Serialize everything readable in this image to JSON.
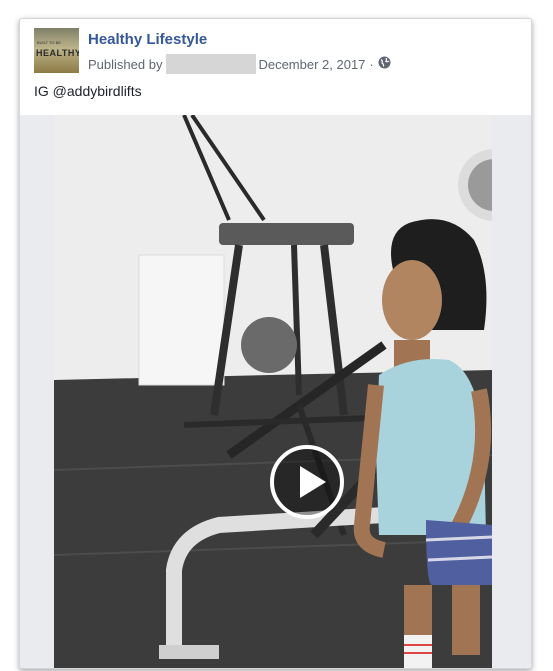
{
  "post": {
    "page_name": "Healthy Lifestyle",
    "published_by_label": "Published by",
    "date": "December 2, 2017",
    "separator": "·",
    "caption": "IG @addybirdlifts",
    "avatar_text": "HEALTHY",
    "avatar_top_text": "BUILT TO BE"
  },
  "icons": {
    "audience": "globe-icon",
    "play": "play-icon"
  },
  "colors": {
    "link": "#365899",
    "meta": "#606770",
    "text": "#1d2129"
  }
}
